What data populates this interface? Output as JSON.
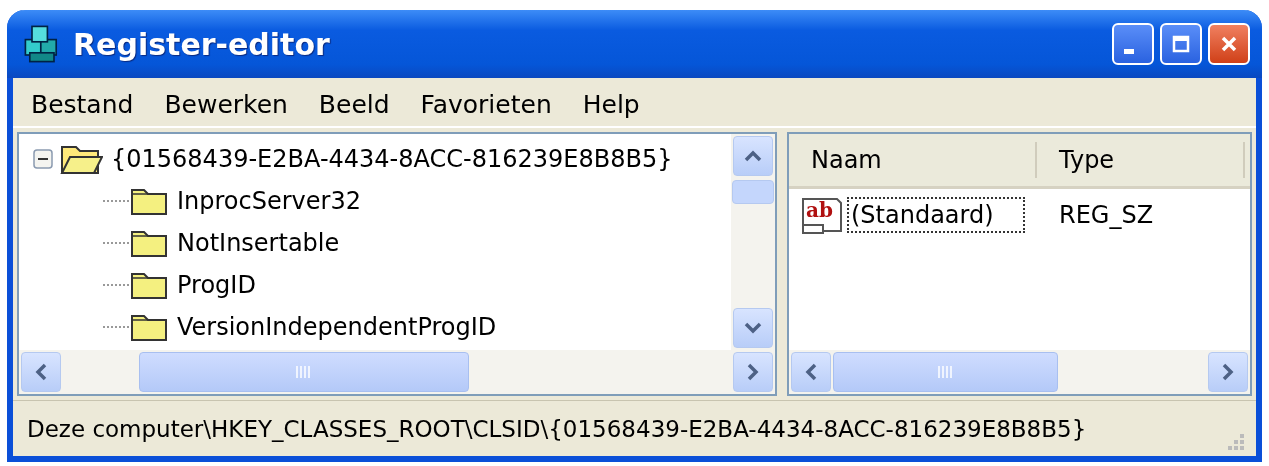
{
  "window": {
    "title": "Register-editor"
  },
  "menu": [
    "Bestand",
    "Bewerken",
    "Beeld",
    "Favorieten",
    "Help"
  ],
  "tree": [
    {
      "label": "{01568439-E2BA-4434-8ACC-816239E8B8B5}",
      "expanded": true,
      "children": [
        {
          "label": "InprocServer32"
        },
        {
          "label": "NotInsertable"
        },
        {
          "label": "ProgID"
        },
        {
          "label": "VersionIndependentProgID"
        }
      ]
    }
  ],
  "columns": [
    "Naam",
    "Type"
  ],
  "values": [
    {
      "icon_text": "ab",
      "name": "(Standaard)",
      "type": "REG_SZ",
      "selected": true
    }
  ],
  "status_bar": "Deze computer\\HKEY_CLASSES_ROOT\\CLSID\\{01568439-E2BA-4434-8ACC-816239E8B8B5}"
}
